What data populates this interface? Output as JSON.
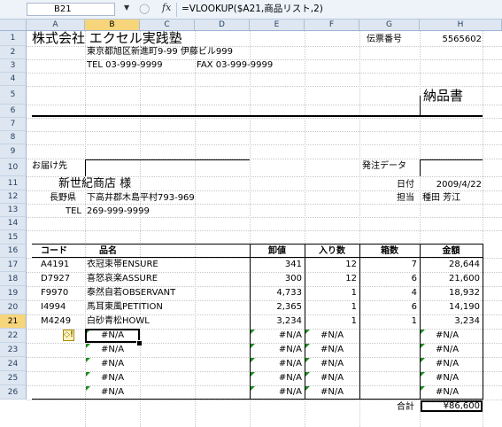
{
  "formula_bar": {
    "name_box": "B21",
    "fx_label": "fx",
    "formula": "=VLOOKUP($A21,商品リスト,2)"
  },
  "columns": [
    "A",
    "B",
    "C",
    "D",
    "E",
    "F",
    "G",
    "H"
  ],
  "selected_column": "B",
  "rows": [
    "1",
    "2",
    "3",
    "4",
    "5",
    "6",
    "7",
    "8",
    "9",
    "10",
    "11",
    "12",
    "13",
    "14",
    "15",
    "16",
    "17",
    "18",
    "19",
    "20",
    "21",
    "22",
    "23",
    "24",
    "25",
    "26"
  ],
  "selected_row": "21",
  "header": {
    "company": "株式会社 エクセル実践塾",
    "address": "東京都旭区新進町9-99 伊藤ビル999",
    "tel": "TEL 03-999-9999",
    "fax": "FAX 03-999-9999",
    "slip_label": "伝票番号",
    "slip_number": "5565602",
    "doc_title": "納品書"
  },
  "recipient": {
    "label": "お届け先",
    "name": "新世紀商店 様",
    "pref": "長野県",
    "address": "下高井郡木島平村793-969",
    "tel_label": "TEL",
    "tel": "269-999-9999"
  },
  "order": {
    "label": "発注データ",
    "date_label": "日付",
    "date": "2009/4/22",
    "staff_label": "担当",
    "staff": "種田 芳江"
  },
  "table": {
    "headers": [
      "コード",
      "品名",
      "卸値",
      "入り数",
      "箱数",
      "金額"
    ],
    "rows": [
      [
        "A4191",
        "衣冠束帯ENSURE",
        "341",
        "12",
        "7",
        "28,644"
      ],
      [
        "D7927",
        "喜怒哀楽ASSURE",
        "300",
        "12",
        "6",
        "21,600"
      ],
      [
        "F9970",
        "泰然自若OBSERVANT",
        "4,733",
        "1",
        "4",
        "18,932"
      ],
      [
        "I4994",
        "馬耳東風PETITION",
        "2,365",
        "1",
        "6",
        "14,190"
      ],
      [
        "M4249",
        "白砂青松HOWL",
        "3,234",
        "1",
        "1",
        "3,234"
      ]
    ],
    "na": "#N/A",
    "warn_icon": "◇!",
    "total_label": "合計",
    "total": "¥86,600"
  }
}
